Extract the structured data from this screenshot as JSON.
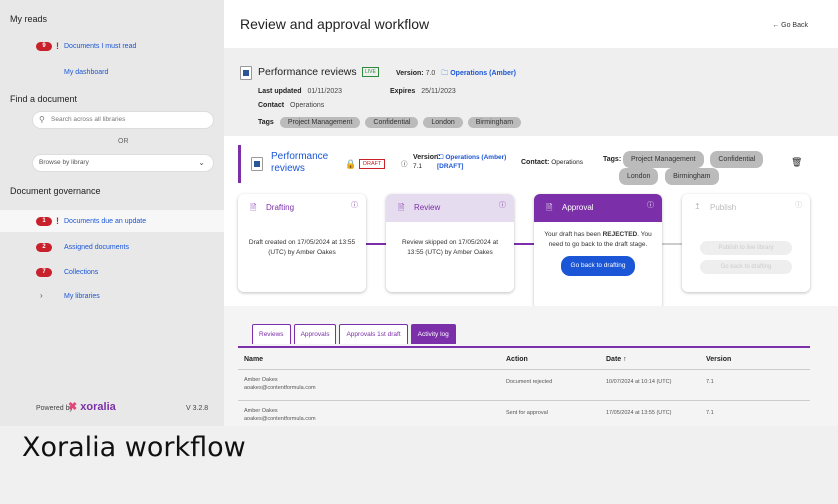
{
  "sidebar": {
    "my_reads": "My reads",
    "documents_must_read": {
      "count": "9",
      "label": "Documents I must read"
    },
    "dashboard": "My dashboard",
    "find_document": "Find a document",
    "search_placeholder": "Search across all libraries",
    "or_text": "OR",
    "browse_placeholder": "Browse by library",
    "governance": "Document governance",
    "governance_items": [
      {
        "count": "1",
        "label": "Documents due an update",
        "urgent": true
      },
      {
        "count": "2",
        "label": "Assigned documents"
      },
      {
        "count": "7",
        "label": "Collections"
      }
    ],
    "my_libraries": "My libraries",
    "powered_by": "Powered by",
    "brand": "xoralia",
    "version": "V 3.2.8"
  },
  "header": {
    "title": "Review and approval workflow",
    "go_back": "Go Back"
  },
  "doc_header": {
    "title": "Performance reviews",
    "status": "LIVE",
    "version_label": "Version:",
    "version_value": "7.0",
    "library": "Operations (Amber)",
    "last_updated_label": "Last updated",
    "last_updated": "01/11/2023",
    "expires_label": "Expires",
    "expires": "25/11/2023",
    "contact_label": "Contact",
    "contact": "Operations",
    "tags_label": "Tags",
    "tags": [
      "Project Management",
      "Confidential",
      "London",
      "Birmingham"
    ]
  },
  "draft_bar": {
    "title": "Performance reviews",
    "status": "DRAFT",
    "version_label": "Version:",
    "version_value": "7.1",
    "library": "Operations (Amber) [DRAFT]",
    "contact_label": "Contact:",
    "contact": "Operations",
    "tags_label": "Tags:",
    "tags": [
      "Project Management",
      "Confidential",
      "London",
      "Birmingham"
    ]
  },
  "stages": [
    {
      "name": "Drafting",
      "text": "Draft created on 17/05/2024 at 13:55 (UTC) by Amber Oakes"
    },
    {
      "name": "Review",
      "text": "Review skipped on 17/05/2024 at 13:55 (UTC) by Amber Oakes"
    },
    {
      "name": "Approval",
      "text_pre": "Your draft has been ",
      "text_bold": "REJECTED",
      "text_post": ". You need to go back to the draft stage.",
      "button": "Go back to drafting"
    },
    {
      "name": "Publish",
      "button1": "Publish to live library",
      "button2": "Go back to drafting"
    }
  ],
  "tabs": [
    "Reviews",
    "Approvals",
    "Approvals 1st draft",
    "Activity log"
  ],
  "table": {
    "headers": [
      "Name",
      "Action",
      "Date ↑",
      "Version"
    ],
    "rows": [
      {
        "name": "Amber Oakes",
        "email": "aoakes@contentformula.com",
        "action": "Document rejected",
        "date": "10/07/2024 at 10:14 (UTC)",
        "version": "7.1"
      },
      {
        "name": "Amber Oakes",
        "email": "aoakes@contentformula.com",
        "action": "Sent for approval",
        "date": "17/05/2024 at 13:55 (UTC)",
        "version": "7.1"
      }
    ]
  },
  "caption": "Xoralia workflow",
  "colors": {
    "accent": "#7b2fa8",
    "link": "#1a56d6",
    "danger": "#c8212b"
  },
  "icons": [
    "search-icon",
    "chevron-down-icon",
    "chevron-right-icon",
    "arrow-left-icon",
    "folder-icon",
    "word-doc-icon",
    "lock-icon",
    "info-icon",
    "delete-icon",
    "upload-icon"
  ]
}
